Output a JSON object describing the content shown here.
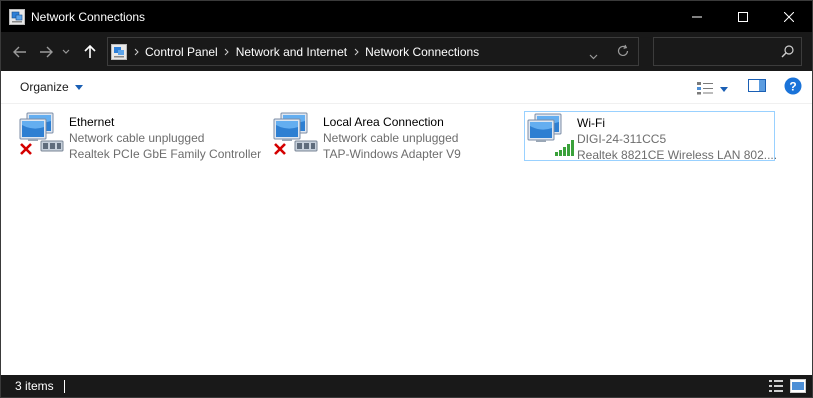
{
  "window": {
    "title": "Network Connections"
  },
  "address": {
    "crumbs": [
      "Control Panel",
      "Network and Internet",
      "Network Connections"
    ]
  },
  "search": {
    "placeholder": ""
  },
  "toolbar": {
    "organize_label": "Organize"
  },
  "items": [
    {
      "name": "Ethernet",
      "status": "Network cable unplugged",
      "device": "Realtek PCIe GbE Family Controller",
      "state": "unplugged"
    },
    {
      "name": "Local Area Connection",
      "status": "Network cable unplugged",
      "device": "TAP-Windows Adapter V9",
      "state": "unplugged"
    },
    {
      "name": "Wi-Fi",
      "status": "DIGI-24-311CC5",
      "device": "Realtek 8821CE Wireless LAN 802....",
      "state": "connected-wifi"
    }
  ],
  "statusbar": {
    "count": "3 items"
  },
  "colors": {
    "titlebar": "#000000",
    "navbar": "#191919",
    "selection_border": "#99d1ff",
    "secondary_text": "#6d6d6d",
    "help_blue": "#1a73d9",
    "unplugged_red": "#d40000",
    "signal_green": "#3aa13a"
  }
}
